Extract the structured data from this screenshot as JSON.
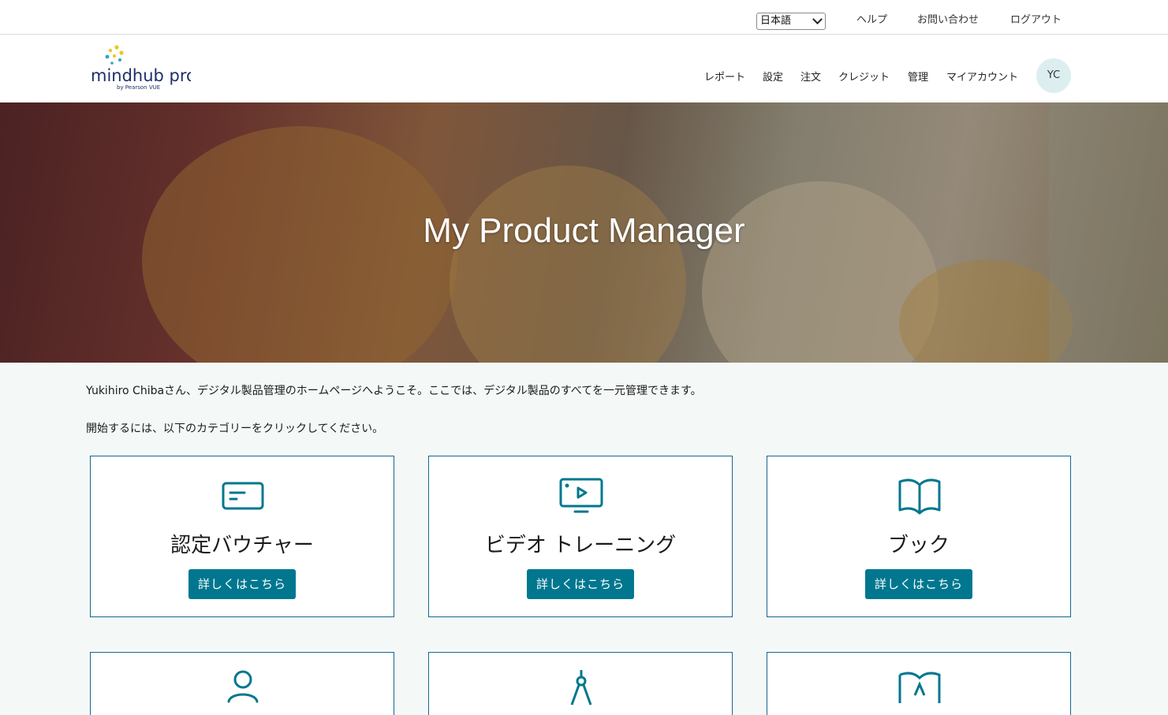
{
  "topbar": {
    "language": "日本語",
    "links": [
      "ヘルプ",
      "お問い合わせ",
      "ログアウト"
    ]
  },
  "brand": {
    "name": "mindhub pro",
    "byline": "by Pearson VUE"
  },
  "nav": {
    "items": [
      "レポート",
      "設定",
      "注文",
      "クレジット",
      "管理",
      "マイアカウント"
    ],
    "avatar_initials": "YC"
  },
  "hero": {
    "title": "My Product Manager"
  },
  "intro": {
    "welcome": "Yukihiro Chibaさん、デジタル製品管理のホームページへようこそ。ここでは、デジタル製品のすべてを一元管理できます。",
    "instruction": "開始するには、以下のカテゴリーをクリックしてください。"
  },
  "cards": [
    {
      "title": "認定バウチャー",
      "button": "詳しくはこちら",
      "icon": "voucher-card-icon"
    },
    {
      "title": "ビデオ トレーニング",
      "button": "詳しくはこちら",
      "icon": "video-training-icon"
    },
    {
      "title": "ブック",
      "button": "詳しくはこちら",
      "icon": "open-book-icon"
    },
    {
      "icon": "person-icon"
    },
    {
      "icon": "compass-icon"
    },
    {
      "icon": "map-book-icon"
    }
  ],
  "colors": {
    "accent": "#00778f",
    "card_border": "#16688a",
    "page_background": "#f4f9f8"
  }
}
